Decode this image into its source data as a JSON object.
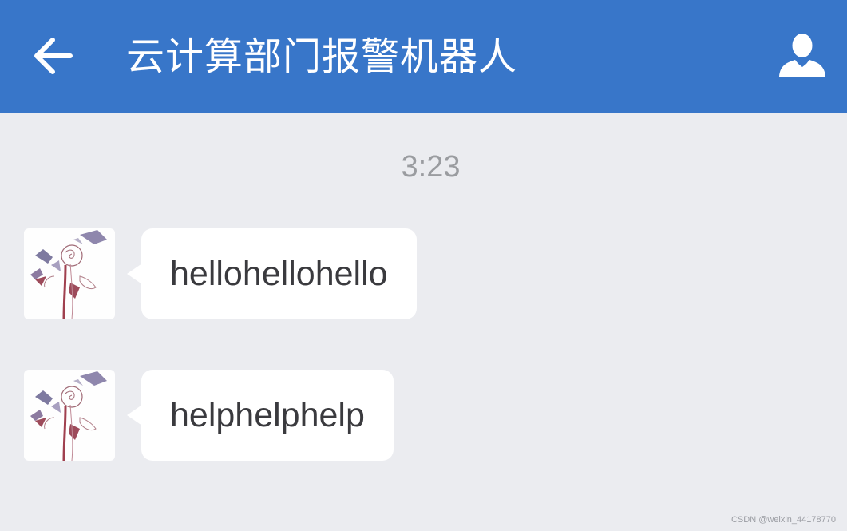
{
  "header": {
    "back_icon": "arrow-left-icon",
    "title": "云计算部门报警机器人",
    "profile_icon": "person-icon",
    "background": "#3876c9"
  },
  "chat": {
    "timestamp": "3:23",
    "messages": [
      {
        "text": "hellohellohello",
        "avatar_icon": "rose-drawing-avatar"
      },
      {
        "text": "helphelphelp",
        "avatar_icon": "rose-drawing-avatar"
      }
    ]
  },
  "watermark": "CSDN @weixin_44178770"
}
